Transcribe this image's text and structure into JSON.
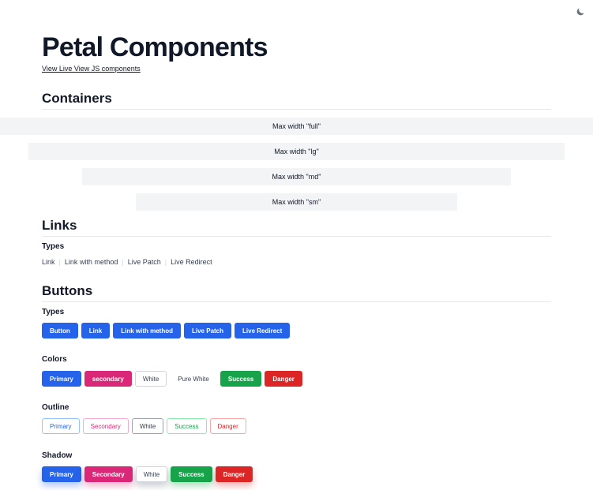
{
  "header": {
    "title": "Petal Components",
    "subtitle_link": "View Live View JS components",
    "theme_toggle_icon": "moon-icon"
  },
  "containers": {
    "heading": "Containers",
    "boxes": [
      "Max width \"full\"",
      "Max width \"lg\"",
      "Max width \"md\"",
      "Max width \"sm\""
    ]
  },
  "links": {
    "heading": "Links",
    "types_label": "Types",
    "separator": "|",
    "items": [
      "Link",
      "Link with method",
      "Live Patch",
      "Live Redirect"
    ]
  },
  "buttons": {
    "heading": "Buttons",
    "types": {
      "label": "Types",
      "items": [
        "Button",
        "Link",
        "Link with method",
        "Live Patch",
        "Live Redirect"
      ]
    },
    "colors": {
      "label": "Colors",
      "items": [
        "Primary",
        "secondary",
        "White",
        "Pure White",
        "Success",
        "Danger"
      ]
    },
    "outline": {
      "label": "Outline",
      "items": [
        "Primary",
        "Secondary",
        "White",
        "Success",
        "Danger"
      ]
    },
    "shadow": {
      "label": "Shadow",
      "items": [
        "Primary",
        "Secondary",
        "White",
        "Success",
        "Danger"
      ]
    }
  },
  "colors": {
    "primary": "#2563eb",
    "secondary": "#db2777",
    "success": "#16a34a",
    "danger": "#dc2626",
    "container_bg": "#f3f4f6"
  }
}
